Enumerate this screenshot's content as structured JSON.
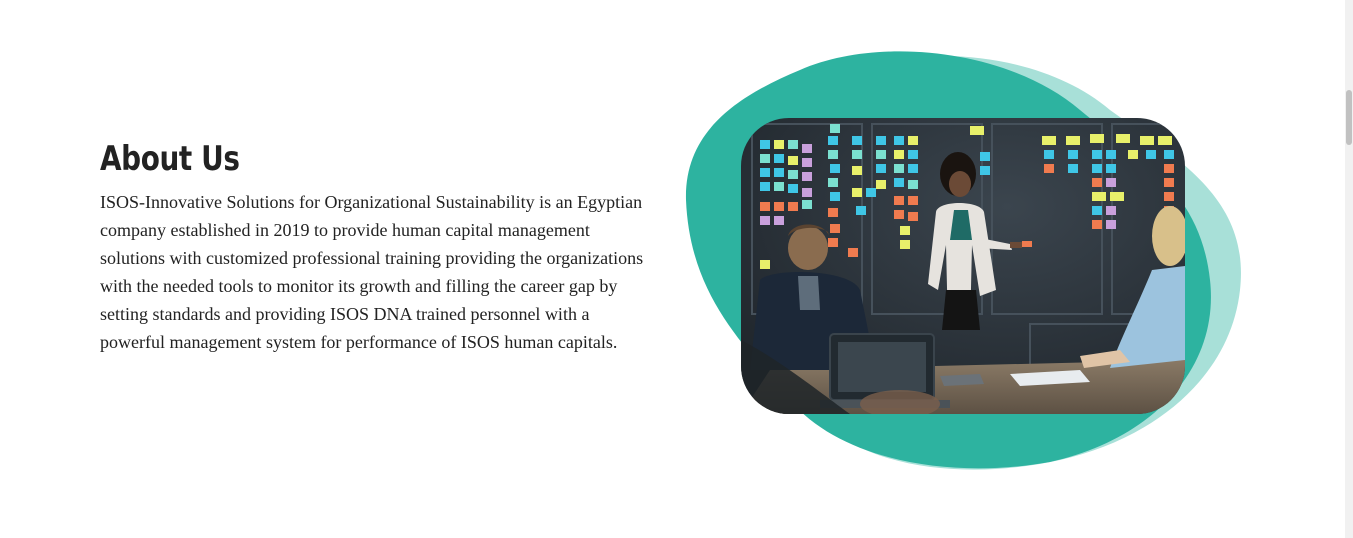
{
  "about": {
    "title": "About Us",
    "body": "ISOS-Innovative Solutions for Organizational Sustainability is an Egyptian company established in 2019 to provide human capital management solutions with customized professional training providing the organizations with the needed tools to monitor its growth and filling the career gap by setting standards and providing ISOS DNA trained personnel with a powerful management system for performance of ISOS human capitals."
  },
  "colors": {
    "blob_primary": "#2db3a0",
    "blob_secondary": "#a8e0d8",
    "wall": "#2c343c",
    "text": "#222222",
    "notes": [
      "#e8f06a",
      "#3fc6e6",
      "#f07b4f",
      "#c9a0dc",
      "#7be0d0",
      "#f5d84a"
    ]
  }
}
